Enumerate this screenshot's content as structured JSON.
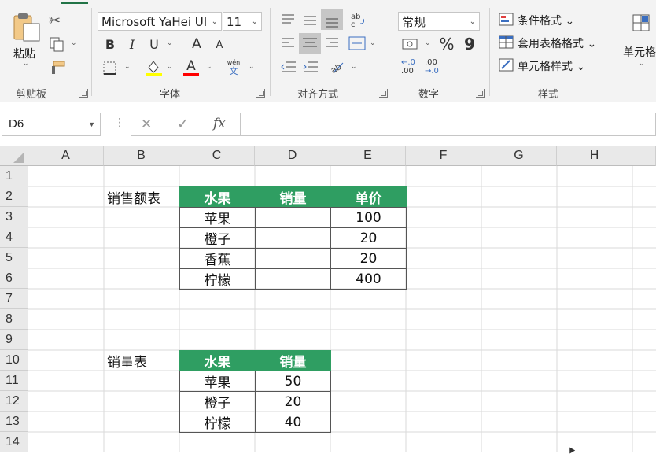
{
  "ribbon": {
    "clipboard": {
      "paste_label": "粘贴",
      "group_label": "剪贴板"
    },
    "font": {
      "font_name": "Microsoft YaHei UI",
      "font_size": "11",
      "bold": "B",
      "italic": "I",
      "underline": "U",
      "grow": "A",
      "shrink": "A",
      "wen_label": "wén",
      "wen_char": "文",
      "group_label": "字体",
      "fill_color": "#ffff00",
      "font_color": "#ff0000"
    },
    "alignment": {
      "group_label": "对齐方式"
    },
    "number": {
      "format": "常规",
      "percent": "%",
      "comma": "9",
      "inc_decimal": ".00",
      "dec_decimal": ".0",
      "group_label": "数字"
    },
    "styles": {
      "conditional": "条件格式",
      "table_format": "套用表格格式",
      "cell_styles": "单元格样式",
      "group_label": "样式"
    },
    "cells": {
      "label": "单元格"
    }
  },
  "formula_bar": {
    "name_box": "D6",
    "cancel": "✕",
    "enter": "✓",
    "fx": "fx",
    "value": ""
  },
  "grid": {
    "columns": [
      "A",
      "B",
      "C",
      "D",
      "E",
      "F",
      "G",
      "H"
    ],
    "rows": [
      "1",
      "2",
      "3",
      "4",
      "5",
      "6",
      "7",
      "8",
      "9",
      "10",
      "11",
      "12",
      "13",
      "14"
    ]
  },
  "sales_table": {
    "title": "销售额表",
    "headers": [
      "水果",
      "销量",
      "单价"
    ],
    "rows": [
      {
        "fruit": "苹果",
        "qty": "",
        "price": "100"
      },
      {
        "fruit": "橙子",
        "qty": "",
        "price": "20"
      },
      {
        "fruit": "香蕉",
        "qty": "",
        "price": "20"
      },
      {
        "fruit": "柠檬",
        "qty": "",
        "price": "400"
      }
    ]
  },
  "qty_table": {
    "title": "销量表",
    "headers": [
      "水果",
      "销量"
    ],
    "rows": [
      {
        "fruit": "苹果",
        "qty": "50"
      },
      {
        "fruit": "橙子",
        "qty": "20"
      },
      {
        "fruit": "柠檬",
        "qty": "40"
      }
    ]
  },
  "colors": {
    "header_green": "#2f9e62",
    "accent": "#217346"
  }
}
